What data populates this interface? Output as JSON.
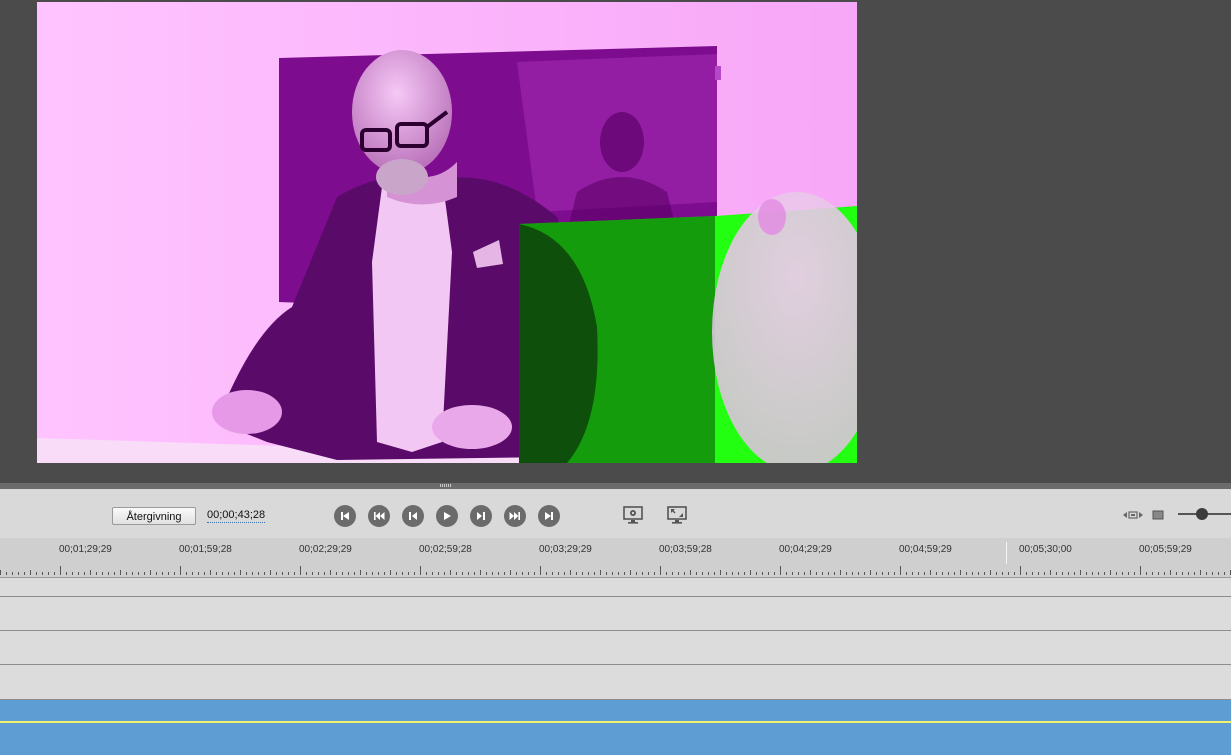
{
  "transport": {
    "render_label": "Återgivning",
    "timecode": "00;00;43;28",
    "buttons": [
      {
        "name": "go-to-start-button",
        "icon": "go-to-start-icon"
      },
      {
        "name": "previous-edit-button",
        "icon": "rewind-icon"
      },
      {
        "name": "step-back-button",
        "icon": "step-back-icon"
      },
      {
        "name": "play-button",
        "icon": "play-icon"
      },
      {
        "name": "step-forward-button",
        "icon": "step-forward-icon"
      },
      {
        "name": "next-edit-button",
        "icon": "fast-forward-icon"
      },
      {
        "name": "go-to-end-button",
        "icon": "go-to-end-icon"
      }
    ],
    "view_buttons": [
      {
        "name": "monitor-settings-button",
        "icon": "monitor-gear-icon"
      },
      {
        "name": "fullscreen-button",
        "icon": "monitor-expand-icon"
      }
    ]
  },
  "ruler": {
    "labels": [
      "00;01;29;29",
      "00;01;59;28",
      "00;02;29;29",
      "00;02;59;28",
      "00;03;29;29",
      "00;03;59;28",
      "00;04;29;29",
      "00;04;59;29",
      "00;05;30;00",
      "00;05;59;29"
    ]
  },
  "colors": {
    "video_tint": "#cc33cc",
    "green_screen": "#22ff11",
    "audio_track": "#5e9dd4",
    "audio_level_line": "#f2f26a"
  }
}
